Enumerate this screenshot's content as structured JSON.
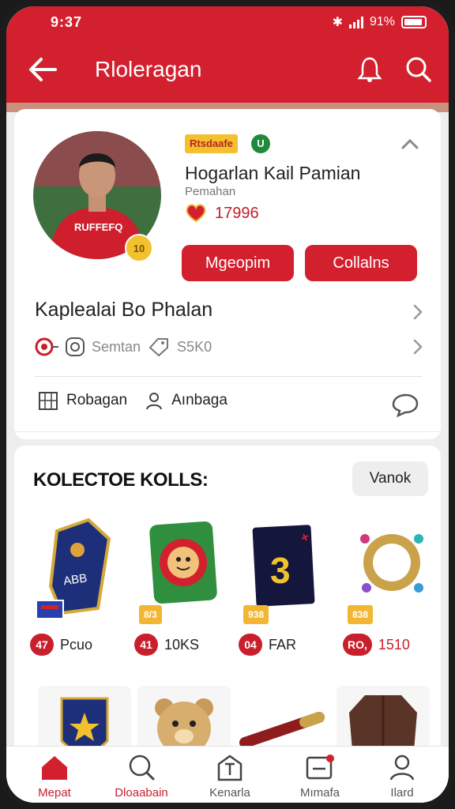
{
  "status": {
    "time": "9:37",
    "battery": "91%"
  },
  "header": {
    "title": "Rloleragan",
    "back_icon": "arrow-left-icon",
    "bell_icon": "bell-icon",
    "search_icon": "search-icon"
  },
  "colors": {
    "brand": "#d3202e",
    "accent_gold": "#f2b632",
    "text": "#222222"
  },
  "profile": {
    "tag": "Rtsdaafe",
    "tag_check": "U",
    "name": "Hogarlan Kail Pamian",
    "subtitle": "Pemahan",
    "avatar_badge": "10",
    "likes": "17996",
    "btn_primary": "Mgeopim",
    "btn_secondary": "Collalns",
    "section_title": "Kaplealai Bo Phalan",
    "stat_label": "Semtan",
    "stat_value": "S5K0",
    "meta_left": "Robagan",
    "meta_right": "Aınbaga"
  },
  "collection": {
    "title": "KOLECTOE KOLLS:",
    "view_button": "Vanok",
    "items": [
      {
        "badge": "",
        "pill": "47",
        "label": "Pcuo"
      },
      {
        "badge": "8/3",
        "pill": "41",
        "label": "10KS"
      },
      {
        "badge": "938",
        "pill": "04",
        "label": "FAR"
      },
      {
        "badge": "838",
        "pill": "RO,",
        "label": "1510"
      }
    ]
  },
  "nav": [
    {
      "label": "Mepat",
      "icon": "home-icon"
    },
    {
      "label": "Dloaabain",
      "icon": "search-icon"
    },
    {
      "label": "Kenarla",
      "icon": "hammer-icon"
    },
    {
      "label": "Mımafa",
      "icon": "message-icon"
    },
    {
      "label": "Ilard",
      "icon": "user-icon"
    }
  ]
}
